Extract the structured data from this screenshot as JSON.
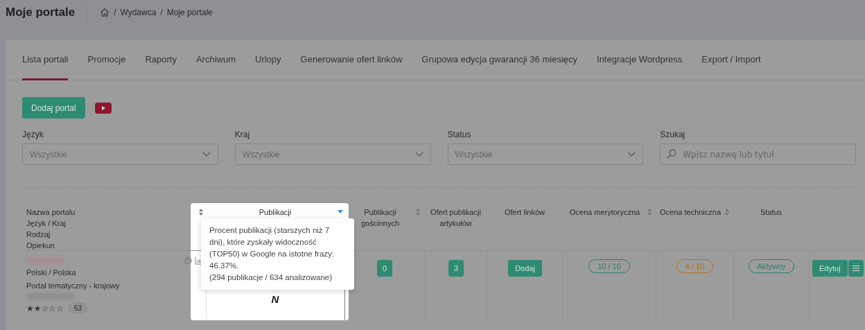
{
  "header": {
    "title": "Moje portale",
    "breadcrumb": [
      "Wydawca",
      "Moje portale"
    ],
    "separator": "/"
  },
  "tabs": [
    {
      "label": "Lista portali",
      "selected": true
    },
    {
      "label": "Promocje",
      "selected": false
    },
    {
      "label": "Raporty",
      "selected": false
    },
    {
      "label": "Archiwum",
      "selected": false
    },
    {
      "label": "Urlopy",
      "selected": false
    },
    {
      "label": "Generowanie ofert linków",
      "selected": false
    },
    {
      "label": "Grupowa edycja gwarancji 36 miesięcy",
      "selected": false
    },
    {
      "label": "Integracje Wordpress",
      "selected": false
    },
    {
      "label": "Export / Import",
      "selected": false
    }
  ],
  "add_button": "Dodaj portal",
  "filters": [
    {
      "label": "Język",
      "kind": "select",
      "placeholder": "Wszystkie"
    },
    {
      "label": "Kraj",
      "kind": "select",
      "placeholder": "Wszystkie"
    },
    {
      "label": "Status",
      "kind": "select",
      "placeholder": "Wszystkie"
    },
    {
      "label": "Szukaj",
      "kind": "search",
      "placeholder": "Wpisz nazwę lub tytuł"
    }
  ],
  "table": {
    "columns": [
      {
        "lines": [
          "Nazwa portalu",
          "Język / Kraj",
          "Rodzaj",
          "Opiekun"
        ],
        "sortable": false,
        "sorted": false,
        "highlighted": false
      },
      {
        "lines": [
          "Publikacji"
        ],
        "sortable": true,
        "sorted": true,
        "highlighted": true
      },
      {
        "lines": [
          "Publikacji gościnnych"
        ],
        "sortable": true,
        "sorted": false,
        "highlighted": false
      },
      {
        "lines": [
          "Ofert publikacji artykułów"
        ],
        "sortable": false,
        "sorted": false,
        "highlighted": false
      },
      {
        "lines": [
          "Ofert linków"
        ],
        "sortable": false,
        "sorted": false,
        "highlighted": false
      },
      {
        "lines": [
          "Ocena merytoryczna"
        ],
        "sortable": true,
        "sorted": false,
        "highlighted": false
      },
      {
        "lines": [
          "Ocena techniczna"
        ],
        "sortable": true,
        "sorted": false,
        "highlighted": false
      },
      {
        "lines": [
          "Status"
        ],
        "sortable": false,
        "sorted": false,
        "highlighted": false
      }
    ],
    "rows": [
      {
        "lang_country": "Polski / Polska",
        "type": "Portal tematyczny - krajowy",
        "stars": 2,
        "reviews": "63",
        "publications_mark": "N",
        "guest": "0",
        "articles": "3",
        "links_button": "Dodaj",
        "merit": {
          "text": "10 / 10",
          "color": "#2e7d6c"
        },
        "tech": {
          "text": "4 / 10",
          "color": "#b8701f"
        },
        "status": {
          "text": "Aktywny",
          "color": "#2e7d6c"
        },
        "edit_button": "Edytuj"
      }
    ]
  },
  "tooltip": {
    "text": "Procent publikacji (starszych niż 7 dni), które zyskały widoczność (TOP50) w Google na istotne frazy: 46.37%.",
    "detail": "(294 publikacje / 634 analizowane)"
  }
}
